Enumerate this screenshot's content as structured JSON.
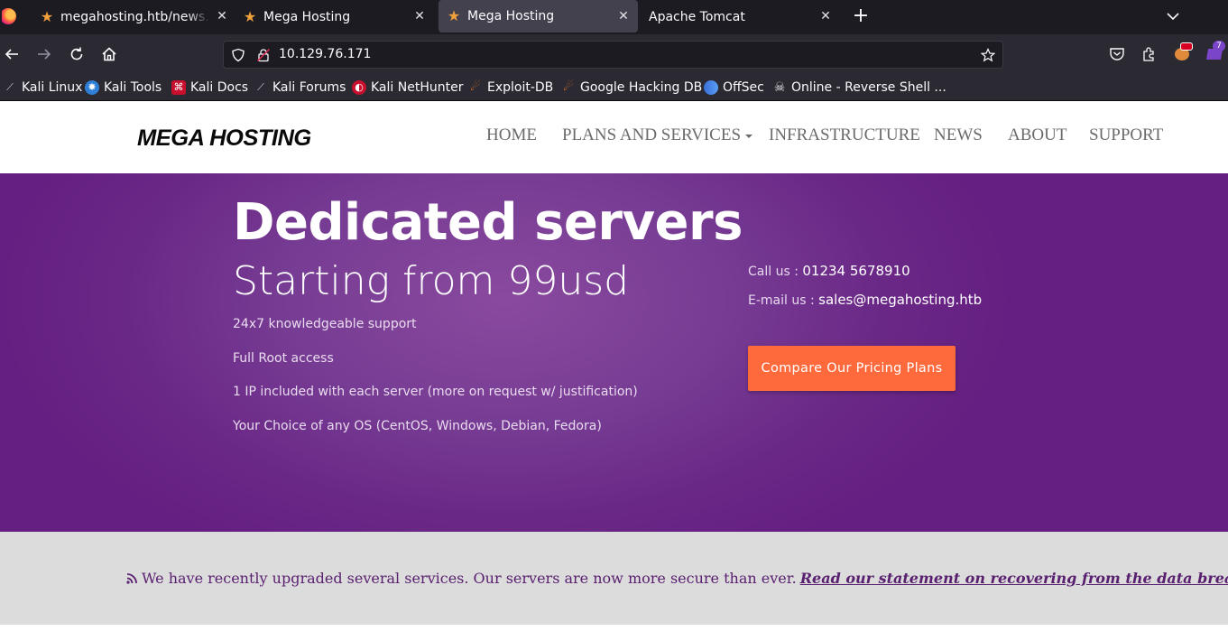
{
  "browser": {
    "tabs": [
      {
        "title": "megahosting.htb/news.php",
        "favicon": "star-icon",
        "active": false
      },
      {
        "title": "Mega Hosting",
        "favicon": "star-icon",
        "active": false
      },
      {
        "title": "Mega Hosting",
        "favicon": "star-icon",
        "active": true
      },
      {
        "title": "Apache Tomcat",
        "favicon": "none",
        "active": false
      }
    ],
    "url": "10.129.76.171",
    "extension_badge": "7",
    "bookmarks": [
      {
        "label": "Kali Linux",
        "icon": "kali-dragon-icon"
      },
      {
        "label": "Kali Tools",
        "icon": "kali-tools-icon"
      },
      {
        "label": "Kali Docs",
        "icon": "kali-docs-icon"
      },
      {
        "label": "Kali Forums",
        "icon": "kali-dragon-icon"
      },
      {
        "label": "Kali NetHunter",
        "icon": "nethunter-icon"
      },
      {
        "label": "Exploit-DB",
        "icon": "exploit-db-icon"
      },
      {
        "label": "Google Hacking DB",
        "icon": "exploit-db-icon"
      },
      {
        "label": "OffSec",
        "icon": "offsec-icon"
      },
      {
        "label": "Online - Reverse Shell ...",
        "icon": "skull-icon"
      }
    ]
  },
  "site": {
    "logo": "MEGA HOSTING",
    "nav": {
      "home": "HOME",
      "plans": "PLANS AND SERVICES",
      "infrastructure": "INFRASTRUCTURE",
      "news": "NEWS",
      "about": "ABOUT",
      "support": "SUPPORT"
    },
    "hero": {
      "title": "Dedicated servers",
      "subtitle": "Starting from 99usd",
      "features": [
        "24x7 knowledgeable support",
        "Full Root access",
        "1 IP included with each server (more on request w/ justification)",
        "Your Choice of any OS (CentOS, Windows, Debian, Fedora)"
      ],
      "call_label": "Call us : ",
      "phone": "01234 5678910",
      "email_label": "E-mail us : ",
      "email": "sales@megahosting.htb",
      "cta": "Compare Our Pricing Plans"
    },
    "news": {
      "text": "We have recently upgraded several services. Our servers are now more secure than ever.",
      "link": "Read our statement on recovering from the data breach"
    }
  },
  "colors": {
    "hero_purple": "#6a2886",
    "cta_orange": "#ff6a3d",
    "news_bg": "#dcdcdc",
    "news_text": "#5a2070"
  }
}
